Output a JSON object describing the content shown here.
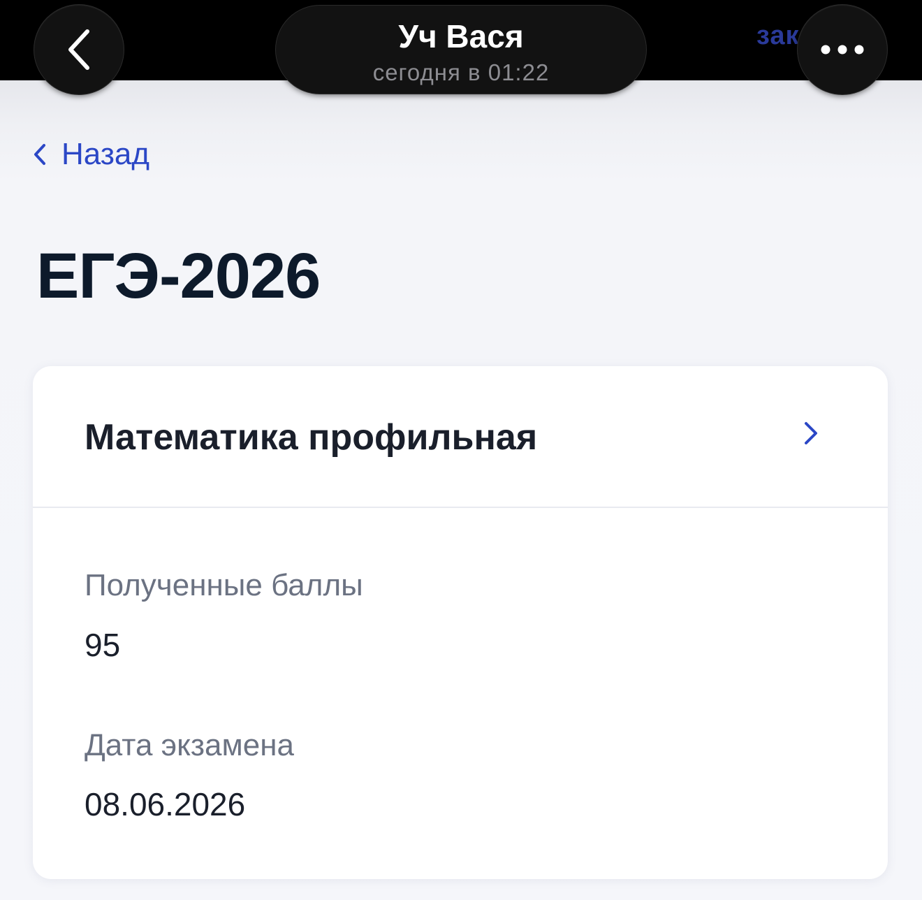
{
  "chat_header": {
    "contact_name": "Уч Вася",
    "timestamp": "сегодня в 01:22",
    "partial_link_text": "зак"
  },
  "page": {
    "back_label": "Назад",
    "title": "ЕГЭ-2026"
  },
  "exam_card": {
    "subject": "Математика профильная",
    "score_label": "Полученные баллы",
    "score_value": "95",
    "date_label": "Дата экзамена",
    "date_value": "08.06.2026"
  },
  "icons": {
    "back": "chevron-left-icon",
    "more": "ellipsis-icon",
    "open_subject": "chevron-right-icon"
  },
  "colors": {
    "accent": "#2b47c6",
    "title_text": "#0d1a2b",
    "label_text": "#6b7282",
    "background": "#f5f6fa",
    "card": "#ffffff"
  }
}
